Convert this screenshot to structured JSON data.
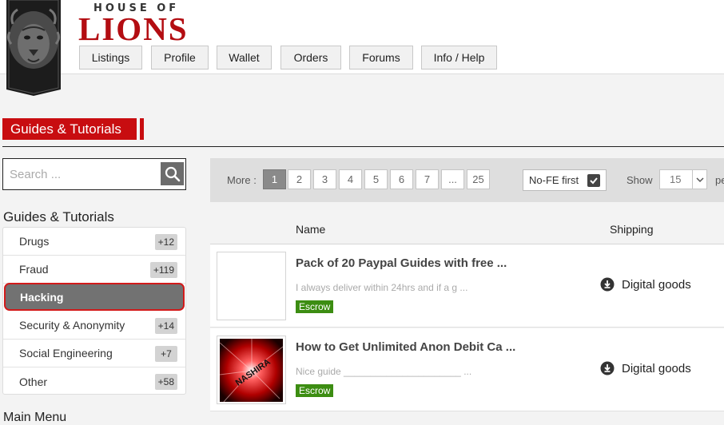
{
  "brand": {
    "small": "HOUSE OF",
    "big": "LIONS"
  },
  "nav": [
    {
      "label": "Listings"
    },
    {
      "label": "Profile"
    },
    {
      "label": "Wallet"
    },
    {
      "label": "Orders"
    },
    {
      "label": "Forums"
    },
    {
      "label": "Info / Help"
    }
  ],
  "section_title": "Guides & Tutorials",
  "search": {
    "placeholder": "Search ..."
  },
  "categories": {
    "heading": "Guides & Tutorials",
    "items": [
      {
        "label": "Drugs",
        "count": "+12"
      },
      {
        "label": "Fraud",
        "count": "+119"
      },
      {
        "label": "Hacking",
        "count": ""
      },
      {
        "label": "Security & Anonymity",
        "count": "+14"
      },
      {
        "label": "Social Engineering",
        "count": "+7"
      },
      {
        "label": "Other",
        "count": "+58"
      }
    ],
    "active_index": 2
  },
  "next_heading": "Main Menu",
  "pager": {
    "more_label": "More :",
    "pages": [
      "1",
      "2",
      "3",
      "4",
      "5",
      "6",
      "7",
      "...",
      "25"
    ],
    "current": "1",
    "nofe_label": "No-FE first",
    "nofe_checked": true,
    "show_label": "Show",
    "show_value": "15",
    "per_label": "pe"
  },
  "columns": {
    "name": "Name",
    "shipping": "Shipping"
  },
  "listings": [
    {
      "title": "Pack of 20 Paypal Guides with free ...",
      "desc": "I always deliver within 24hrs and if a g ...",
      "badge": "Escrow",
      "shipping": "Digital goods",
      "thumb": "blank"
    },
    {
      "title": "How to Get Unlimited Anon Debit Ca ...",
      "desc": "Nice guide ______________________ ...",
      "badge": "Escrow",
      "shipping": "Digital goods",
      "thumb": "red-burst",
      "thumb_text": "NASHIRA"
    }
  ],
  "colors": {
    "brand_red": "#b30d12",
    "title_red": "#c80d10",
    "escrow_green": "#3c8d12",
    "active_border": "#d21a1a"
  }
}
